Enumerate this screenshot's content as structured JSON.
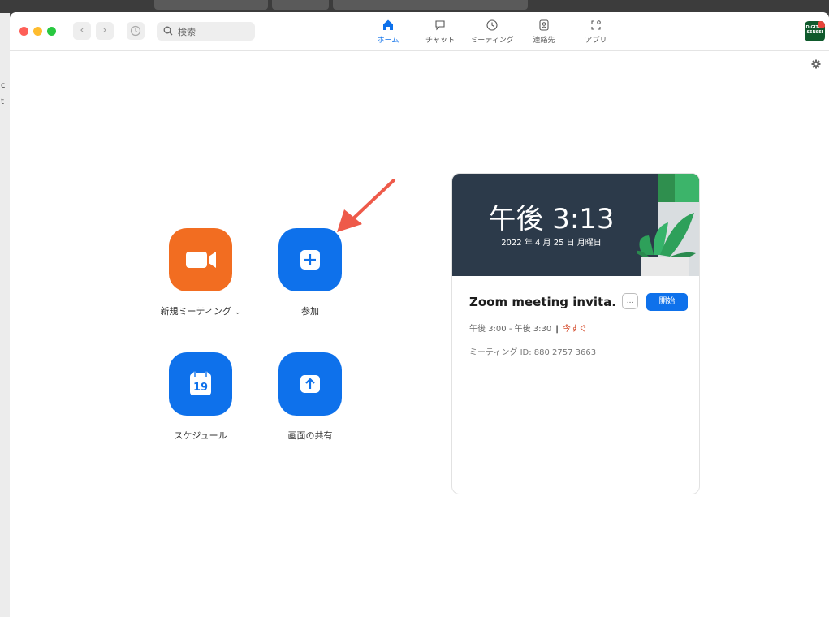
{
  "background": {
    "left_fragments": [
      "c",
      "t"
    ]
  },
  "titlebar": {
    "search_placeholder": "検索",
    "tabs": [
      {
        "label": "ホーム",
        "icon": "home-icon",
        "active": true
      },
      {
        "label": "チャット",
        "icon": "chat-icon",
        "active": false
      },
      {
        "label": "ミーティング",
        "icon": "clock-icon",
        "active": false
      },
      {
        "label": "連絡先",
        "icon": "contacts-icon",
        "active": false
      },
      {
        "label": "アプリ",
        "icon": "apps-icon",
        "active": false
      }
    ],
    "avatar_text": "DIGITAL SENSEI"
  },
  "actions": {
    "new_meeting": "新規ミーティング",
    "join": "参加",
    "schedule": "スケジュール",
    "schedule_day": "19",
    "share_screen": "画面の共有"
  },
  "meeting_card": {
    "clock": "午後 3:13",
    "date": "2022 年 4 月 25 日 月曜日",
    "title": "Zoom meeting invita...",
    "more_label": "...",
    "start_label": "開始",
    "time_range": "午後 3:00 - 午後 3:30",
    "status": "今すぐ",
    "meeting_id": "ミーティング ID: 880 2757 3663"
  },
  "colors": {
    "accent": "#0e71eb",
    "orange": "#f26d21",
    "arrow": "#ee5a4a"
  }
}
